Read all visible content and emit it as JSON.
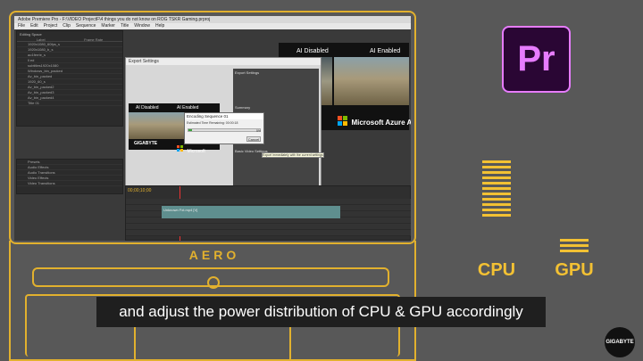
{
  "app": {
    "window_title": "Adobe Premiere Pro - F:\\VIDEO ProjectF\\4 things you do not know on ROG TSKR Gaming.prproj",
    "menu": [
      "File",
      "Edit",
      "Project",
      "Clip",
      "Sequence",
      "Marker",
      "Title",
      "Window",
      "Help"
    ]
  },
  "project_panel": {
    "header": "Editing Space",
    "columns": [
      "Label",
      "Frame Rate"
    ],
    "items": [
      "1920x1080_60fps_s",
      "1920x1080_b_s",
      "ao1ferrie_s",
      "ll ed",
      "subtitles1920x1080",
      "Windows_bin_packed",
      "Av_bin_packed",
      "1920_60_s",
      "Av_bin_packed2",
      "Av_bin_packed3",
      "Av_bin_packed4",
      "Title 01"
    ],
    "effects": [
      "Presets",
      "Audio Effects",
      "Audio Transitions",
      "Video Effects",
      "Video Transitions"
    ]
  },
  "export_dialog": {
    "title": "Export Settings",
    "export_settings_label": "Export Settings",
    "summary_label": "Summary",
    "basic_video_label": "Basic Video Settings",
    "tooltip": "Export immediately with the current settings"
  },
  "previews": {
    "ai_disabled": "AI Disabled",
    "ai_enabled": "AI Enabled",
    "brand": "GIGABYTE",
    "ms_text": "Microsoft Azure A",
    "ms_text_small": "Microsoft",
    "small_ms": "Microsoft Azure A"
  },
  "encoding_dialog": {
    "title": "Encoding Sequence 01",
    "remaining": "Estimated Time Remaining: 00:00:18",
    "percent": "5%",
    "cancel_label": "Cancel",
    "progress": 0.05
  },
  "timeline": {
    "timecode": "00;00;10;00",
    "clip_label": "Unknown Fxt.mp4 [V]"
  },
  "laptop": {
    "brand": "AERO"
  },
  "overlay": {
    "premiere_logo": "Pr",
    "cpu_label": "CPU",
    "gpu_label": "GPU",
    "cpu_bar_count": 11,
    "gpu_bar_count": 3,
    "subtitle": "and adjust the power distribution of CPU & GPU accordingly",
    "badge": "GIGABYTE"
  },
  "colors": {
    "accent": "#f3c133",
    "premiere": "#e77cff",
    "outline": "#e2b12e"
  }
}
